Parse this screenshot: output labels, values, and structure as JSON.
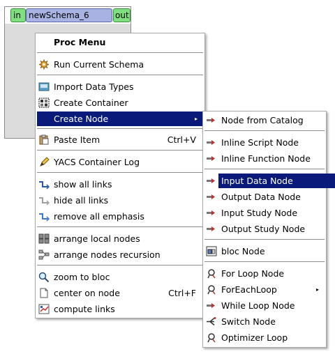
{
  "schema": {
    "in_port": "in",
    "title": "newSchema_6",
    "out_port": "out"
  },
  "proc_menu": {
    "title": "Proc Menu",
    "items": [
      {
        "label": "Run Current Schema",
        "icon": "gear-icon"
      },
      {
        "label": "Import Data Types",
        "icon": "import-icon"
      },
      {
        "label": "Create Container",
        "icon": "container-icon"
      },
      {
        "label": "Create Node",
        "icon": "none",
        "submenu_arrow": "▸"
      },
      {
        "label": "Paste Item",
        "icon": "paste-icon",
        "shortcut": "Ctrl+V"
      },
      {
        "label": "YACS Container Log",
        "icon": "pen-icon"
      },
      {
        "label": "show all links",
        "icon": "show-links-icon"
      },
      {
        "label": "hide all links",
        "icon": "hide-links-icon"
      },
      {
        "label": "remove all emphasis",
        "icon": "emphasis-icon"
      },
      {
        "label": "arrange local nodes",
        "icon": "arrange-local-icon"
      },
      {
        "label": "arrange nodes recursion",
        "icon": "arrange-recursive-icon"
      },
      {
        "label": "zoom to bloc",
        "icon": "magnifier-icon"
      },
      {
        "label": "center on node",
        "icon": "page-icon",
        "shortcut": "Ctrl+F"
      },
      {
        "label": "compute links",
        "icon": "compute-links-icon"
      }
    ]
  },
  "create_node_menu": {
    "items": [
      {
        "label": "Node from Catalog",
        "icon": "node-arrow-icon"
      },
      {
        "label": "Inline Script Node",
        "icon": "node-arrow-icon"
      },
      {
        "label": "Inline Function Node",
        "icon": "node-arrow-icon"
      },
      {
        "label": "Input Data Node",
        "icon": "node-arrow-icon"
      },
      {
        "label": "Output Data Node",
        "icon": "node-arrow-icon"
      },
      {
        "label": "Input Study Node",
        "icon": "node-arrow-icon"
      },
      {
        "label": "Output Study Node",
        "icon": "node-arrow-icon"
      },
      {
        "label": "bloc Node",
        "icon": "bloc-icon"
      },
      {
        "label": "For Loop Node",
        "icon": "loop-icon"
      },
      {
        "label": "ForEachLoop",
        "icon": "loop-icon",
        "submenu_arrow": "▸"
      },
      {
        "label": "While Loop Node",
        "icon": "node-arrow-icon"
      },
      {
        "label": "Switch Node",
        "icon": "switch-icon"
      },
      {
        "label": "Optimizer Loop",
        "icon": "loop-icon"
      }
    ]
  },
  "colors": {
    "highlight": "#0a1a7a",
    "port": "#7fe07f",
    "schema_title": "#a9b3e3"
  }
}
